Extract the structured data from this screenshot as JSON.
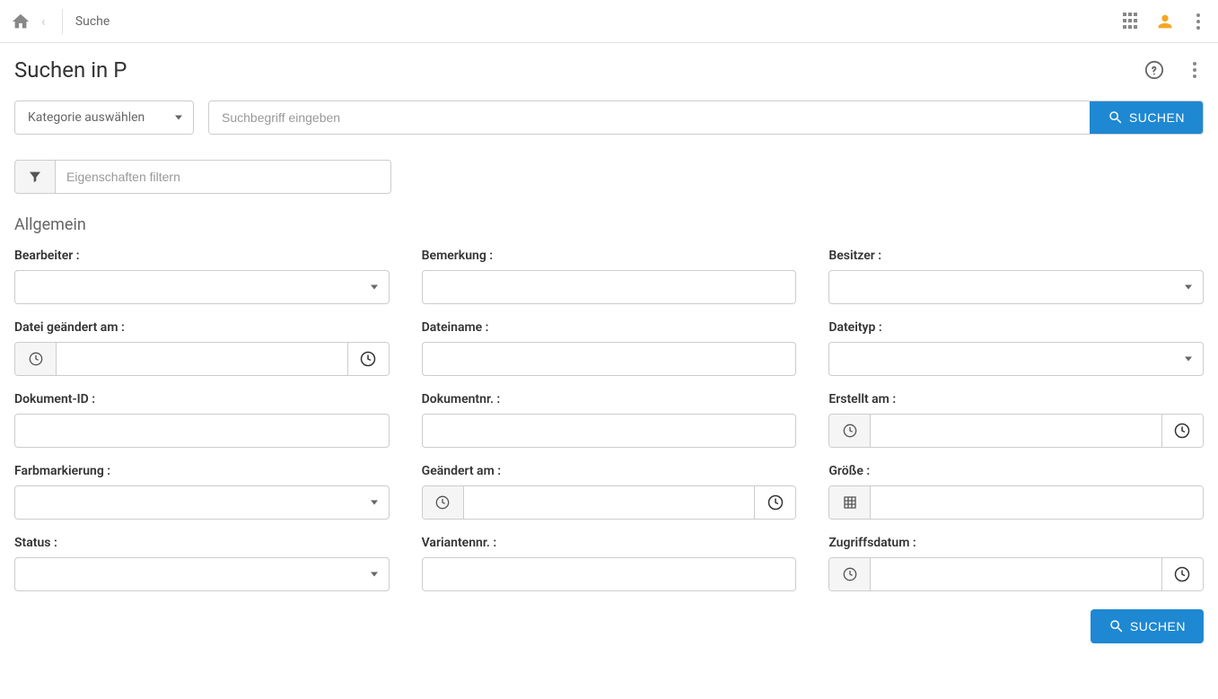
{
  "breadcrumb": {
    "current": "Suche"
  },
  "page": {
    "title": "Suchen in P"
  },
  "category": {
    "placeholder": "Kategorie auswählen"
  },
  "search": {
    "placeholder": "Suchbegriff eingeben",
    "button": "SUCHEN"
  },
  "filter": {
    "placeholder": "Eigenschaften filtern"
  },
  "section": {
    "general": "Allgemein"
  },
  "fields": {
    "bearbeiter": {
      "label": "Bearbeiter :"
    },
    "bemerkung": {
      "label": "Bemerkung :"
    },
    "besitzer": {
      "label": "Besitzer :"
    },
    "datei_geaendert_am": {
      "label": "Datei geändert am :"
    },
    "dateiname": {
      "label": "Dateiname :"
    },
    "dateityp": {
      "label": "Dateityp :"
    },
    "dokument_id": {
      "label": "Dokument-ID :"
    },
    "dokumentnr": {
      "label": "Dokumentnr. :"
    },
    "erstellt_am": {
      "label": "Erstellt am :"
    },
    "farbmarkierung": {
      "label": "Farbmarkierung :"
    },
    "geaendert_am": {
      "label": "Geändert am :"
    },
    "groesse": {
      "label": "Größe :"
    },
    "status": {
      "label": "Status :"
    },
    "variantennr": {
      "label": "Variantennr. :"
    },
    "zugriffsdatum": {
      "label": "Zugriffsdatum :"
    }
  },
  "bottom": {
    "search": "SUCHEN"
  }
}
